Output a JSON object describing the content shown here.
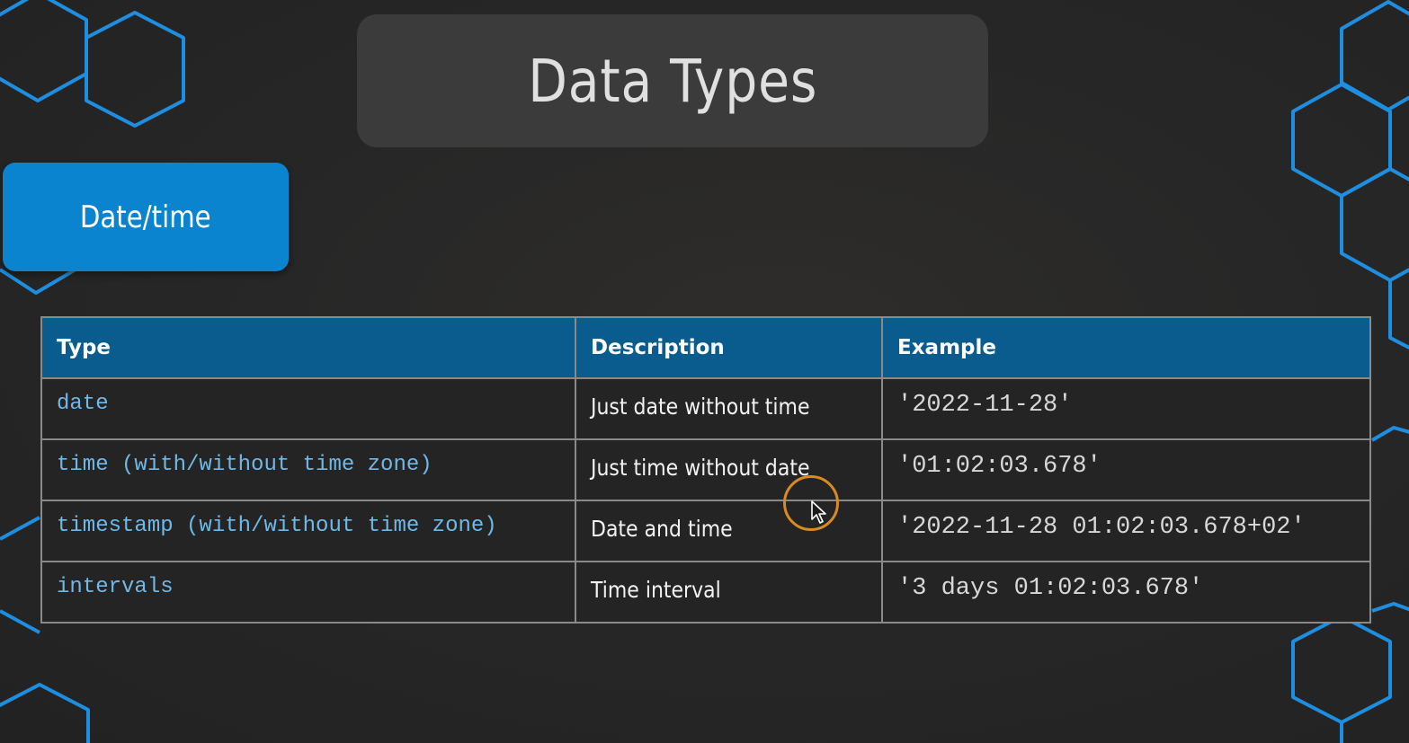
{
  "slide": {
    "title": "Data Types",
    "category": "Date/time"
  },
  "table": {
    "headers": {
      "type": "Type",
      "description": "Description",
      "example": "Example"
    },
    "rows": [
      {
        "type": "date",
        "description": "Just date without time",
        "example": "'2022-11-28'"
      },
      {
        "type": "time (with/without time zone)",
        "description": "Just time without date",
        "example": "'01:02:03.678'"
      },
      {
        "type": "timestamp (with/without time zone)",
        "description": "Date and time",
        "example": "'2022-11-28 01:02:03.678+02'"
      },
      {
        "type": "intervals",
        "description": "Time interval",
        "example": "'3 days 01:02:03.678'"
      }
    ]
  },
  "colors": {
    "accent": "#1e8fe0",
    "badge": "#0a84cf",
    "header_row": "#0a5b8e",
    "background": "#252525",
    "cursor_highlight": "#d98a22"
  },
  "icons": {
    "background_decoration": "hexagon-outline-icon",
    "cursor": "mouse-pointer-icon"
  }
}
